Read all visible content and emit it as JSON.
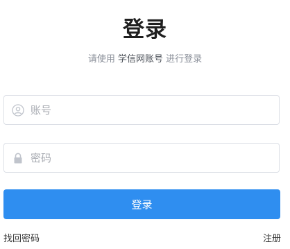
{
  "page": {
    "title": "登录",
    "subtitle_prefix": "请使用",
    "subtitle_highlight": "学信网账号",
    "subtitle_suffix": "进行登录"
  },
  "form": {
    "account_placeholder": "账号",
    "account_icon": "user-icon",
    "password_placeholder": "密码",
    "password_icon": "lock-icon",
    "login_label": "登录"
  },
  "links": {
    "forgot_password": "找回密码",
    "register": "注册"
  },
  "colors": {
    "primary": "#2f8ef0",
    "border": "#dcdfe6",
    "placeholder": "#a8abb2",
    "icon": "#c0c4cc"
  }
}
